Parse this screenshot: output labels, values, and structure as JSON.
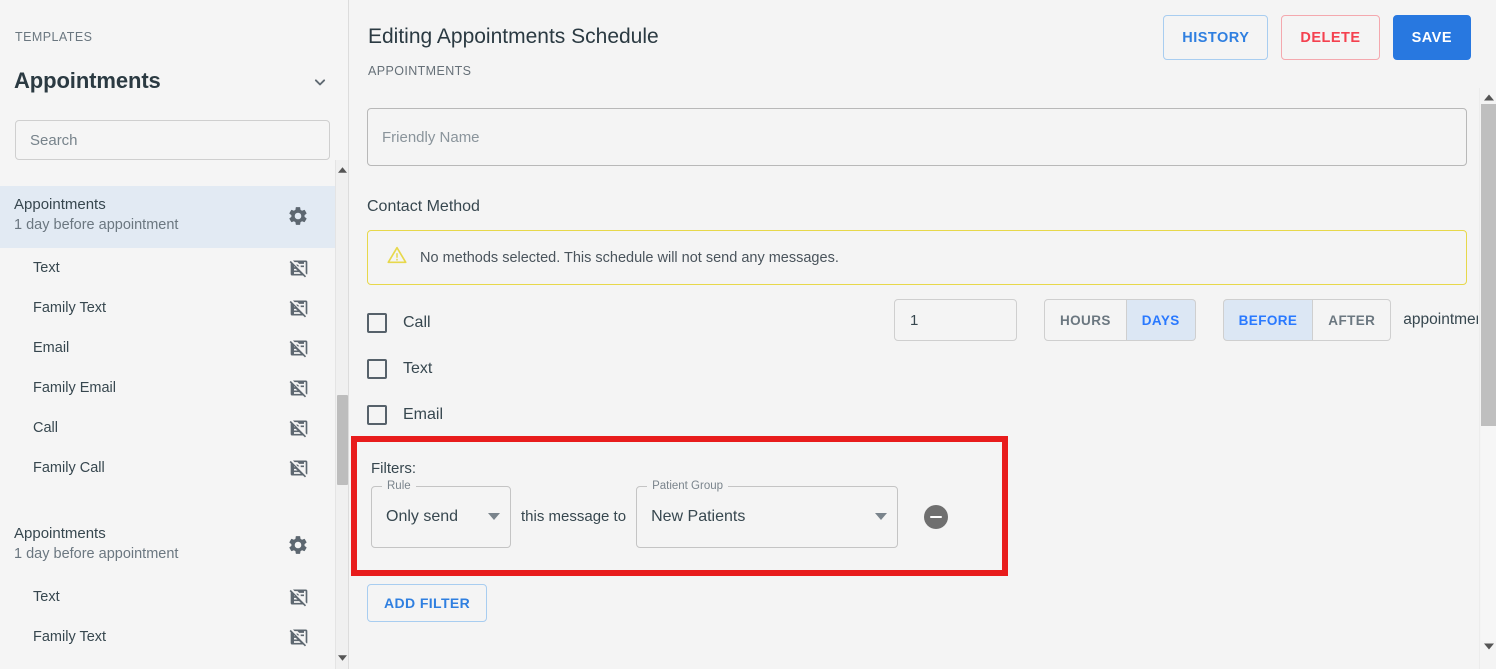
{
  "sidebar": {
    "section_label": "TEMPLATES",
    "title": "Appointments",
    "collapse_icon": "chevron-down-icon",
    "search": {
      "placeholder": "Search",
      "value": ""
    },
    "groups": [
      {
        "name": "Appointments",
        "subtitle": "1 day before appointment",
        "selected": true,
        "gear_icon": "gear-icon",
        "children": [
          {
            "label": "Text",
            "icon": "speaker-notes-off-icon"
          },
          {
            "label": "Family Text",
            "icon": "speaker-notes-off-icon"
          },
          {
            "label": "Email",
            "icon": "speaker-notes-off-icon"
          },
          {
            "label": "Family Email",
            "icon": "speaker-notes-off-icon"
          },
          {
            "label": "Call",
            "icon": "speaker-notes-off-icon"
          },
          {
            "label": "Family Call",
            "icon": "speaker-notes-off-icon"
          }
        ]
      },
      {
        "name": "Appointments",
        "subtitle": "1 day before appointment",
        "selected": false,
        "gear_icon": "gear-icon",
        "children": [
          {
            "label": "Text",
            "icon": "speaker-notes-off-icon"
          },
          {
            "label": "Family Text",
            "icon": "speaker-notes-off-icon"
          }
        ]
      }
    ]
  },
  "header": {
    "title": "Editing Appointments Schedule",
    "breadcrumb": "APPOINTMENTS",
    "buttons": {
      "history": "HISTORY",
      "delete": "DELETE",
      "save": "SAVE"
    }
  },
  "form": {
    "friendly_name": {
      "placeholder": "Friendly Name",
      "value": ""
    },
    "contact_method_label": "Contact Method",
    "warning": {
      "icon": "warning-triangle-icon",
      "text": "No methods selected. This schedule will not send any messages."
    },
    "methods": [
      {
        "label": "Call",
        "checked": false
      },
      {
        "label": "Text",
        "checked": false
      },
      {
        "label": "Email",
        "checked": false
      }
    ],
    "timing": {
      "amount": "1",
      "unit_options": [
        "HOURS",
        "DAYS"
      ],
      "unit_selected": "DAYS",
      "direction_options": [
        "BEFORE",
        "AFTER"
      ],
      "direction_selected": "BEFORE",
      "suffix": "appointment"
    },
    "filters": {
      "label": "Filters:",
      "rows": [
        {
          "rule_legend": "Rule",
          "rule_value": "Only send",
          "connector": "this message to",
          "group_legend": "Patient Group",
          "group_value": "New Patients",
          "remove_icon": "remove-circle-icon"
        }
      ],
      "add_button": "ADD FILTER",
      "highlight_color": "#e81c1c"
    }
  },
  "colors": {
    "accent_blue": "#2878e0",
    "danger_red": "#f4414f",
    "warning_yellow": "#e7d84b",
    "selected_row": "#e2eaf3",
    "toggle_active_bg": "#dce7f4",
    "toggle_active_text": "#2979ff"
  },
  "scrollbars": {
    "sidebar": {
      "up_icon": "caret-up-icon",
      "down_icon": "caret-down-icon"
    },
    "main": {
      "up_icon": "caret-up-icon",
      "down_icon": "caret-down-icon"
    }
  }
}
